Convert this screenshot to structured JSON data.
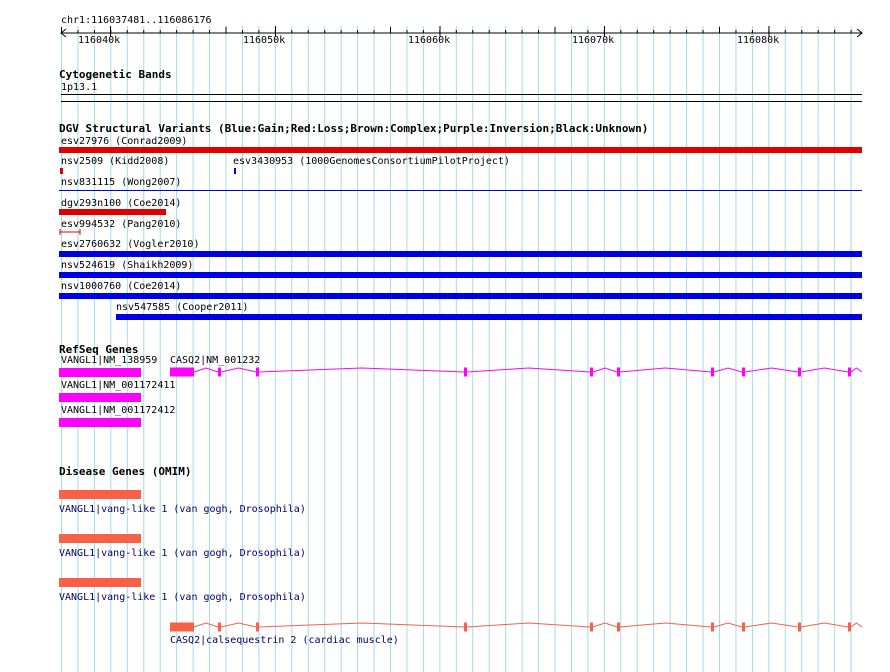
{
  "ruler": {
    "range_label": "chr1:116037481..116086176",
    "ticks": [
      "116040k",
      "116050k",
      "116060k",
      "116070k",
      "116080k"
    ]
  },
  "tracks": {
    "cytoband": {
      "title": "Cytogenetic Bands",
      "band": "1p13.1"
    },
    "dgv": {
      "title": "DGV Structural Variants (Blue:Gain;Red:Loss;Brown:Complex;Purple:Inversion;Black:Unknown)",
      "features": [
        {
          "label": "esv27976 (Conrad2009)",
          "type": "loss"
        },
        {
          "label": "nsv2509 (Kidd2008)",
          "type": "loss"
        },
        {
          "label": "esv3430953 (1000GenomesConsortiumPilotProject)",
          "type": "gain"
        },
        {
          "label": "nsv831115 (Wong2007)",
          "type": "gain"
        },
        {
          "label": "dgv293n100 (Coe2014)",
          "type": "loss"
        },
        {
          "label": "esv994532 (Pang2010)",
          "type": "loss"
        },
        {
          "label": "esv2760632 (Vogler2010)",
          "type": "gain"
        },
        {
          "label": "nsv524619 (Shaikh2009)",
          "type": "gain"
        },
        {
          "label": "nsv1000760 (Coe2014)",
          "type": "gain"
        },
        {
          "label": "nsv547585 (Cooper2011)",
          "type": "gain"
        }
      ]
    },
    "refseq": {
      "title": "RefSeq Genes",
      "genes": [
        {
          "label": "VANGL1|NM_138959"
        },
        {
          "label": "CASQ2|NM_001232"
        },
        {
          "label": "VANGL1|NM_001172411"
        },
        {
          "label": "VANGL1|NM_001172412"
        }
      ]
    },
    "omim": {
      "title": "Disease Genes (OMIM)",
      "genes": [
        {
          "label": "VANGL1|vang-like 1 (van gogh, Drosophila)"
        },
        {
          "label": "VANGL1|vang-like 1 (van gogh, Drosophila)"
        },
        {
          "label": "VANGL1|vang-like 1 (van gogh, Drosophila)"
        },
        {
          "label": "CASQ2|calsequestrin 2 (cardiac muscle)"
        }
      ]
    }
  },
  "colors": {
    "grid": "#a8d8ec",
    "gain": "#0000e0",
    "loss": "#e00000",
    "refseq": "#ff00ff",
    "omim": "#f86048",
    "label_blue": "#00006a"
  }
}
